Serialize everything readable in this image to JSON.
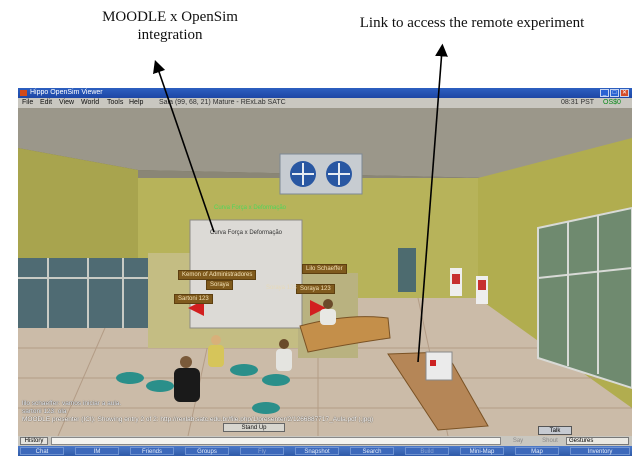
{
  "annotations": {
    "left": "MOODLE x OpenSim integration",
    "right": "Link to access the remote experiment"
  },
  "window": {
    "title": "Hippo OpenSim Viewer",
    "min": "_",
    "max": "□",
    "close": "✕"
  },
  "menubar": {
    "items": [
      "File",
      "Edit",
      "View",
      "World",
      "Tools",
      "Help"
    ],
    "location": "Sala (99, 68, 21) Mature - RExLab SATC",
    "time": "08:31 PST",
    "balance": "OS$0"
  },
  "scene": {
    "board_title": "Curva Força x Deformação",
    "green_label": "Curva Força x Deformação",
    "labels": {
      "l1": "Kemon of Administradores",
      "l2": "Soraya",
      "l3": "Sartoni 123",
      "l4": "Lilo Schaeffer",
      "l5": "Soraya 123",
      "l6": "Soraya 123"
    }
  },
  "chat": {
    "lines": [
      "lilo schaeffer: vamos iniciar a aula.",
      "sartoni 123: ola",
      "MOODLE presenter (ICI): Showing entry 2 of 2: http://rexlab.satc.edu.br/file.php/1/presenter/2/1266887717_Aula.pdf (.jpg)"
    ]
  },
  "buttons": {
    "stand_up": "Stand Up",
    "history": "History",
    "say": "Say",
    "shout": "Shout",
    "gestures": "Gestures",
    "talk": "Talk"
  },
  "toolbar": [
    "Chat",
    "IM",
    "Friends",
    "Groups",
    "Fly",
    "Snapshot",
    "Search",
    "Build",
    "Mini-Map",
    "Map",
    "Inventory"
  ],
  "colors": {
    "title_bar": "#1d46a5",
    "wall_yellow": "#b5b04a",
    "floor_tile": "#c9b9a8"
  }
}
